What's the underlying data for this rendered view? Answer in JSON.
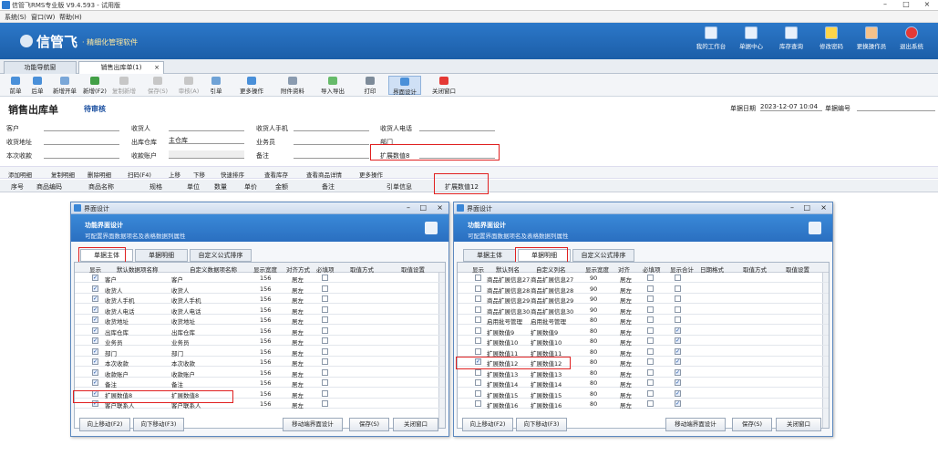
{
  "window": {
    "title": "信管飞RMS专业版 V9.4.593 - 试用版"
  },
  "menu": [
    "系统(S)",
    "窗口(W)",
    "帮助(H)"
  ],
  "banner": {
    "logo": "信管飞",
    "tagline": "· 精细化管理软件",
    "buttons": [
      "我的工作台",
      "单据中心",
      "库存查询",
      "修改密码",
      "更换操作员",
      "退出系统"
    ]
  },
  "tabs": [
    {
      "label": "功能导航窗"
    },
    {
      "label": "销售出库单(1)"
    }
  ],
  "tab_close": "×",
  "toolbar": [
    "前单",
    "后单",
    "新增开单",
    "新增(F2)",
    "复制新增",
    "保存(S)",
    "审核(A)",
    "引单",
    "更多操作",
    "附件资料",
    "导入导出",
    "打印",
    "界面设计",
    "关闭窗口"
  ],
  "doc": {
    "title": "销售出库单",
    "status": "待审核",
    "date_label": "单据日期",
    "date_value": "2023-12-07 10:04",
    "no_label": "单据编号"
  },
  "form": {
    "customer": "客户",
    "receiver": "收货人",
    "receiver_phone": "收货人手机",
    "receiver_tel": "收货人电话",
    "address": "收货地址",
    "warehouse": "出库仓库",
    "warehouse_value": "主仓库",
    "salesman": "业务员",
    "dept": "部门",
    "receipt": "本次收款",
    "account": "收款账户",
    "remark": "备注",
    "ext8": "扩展数值8"
  },
  "detail_toolbar": [
    "添加明细",
    "复制明细",
    "删除明细",
    "扫码(F4)",
    "上移",
    "下移",
    "快速排序",
    "查看库存",
    "查看商品详情",
    "更多操作"
  ],
  "detail_columns": [
    "序号",
    "商品编码",
    "商品名称",
    "规格",
    "单位",
    "数量",
    "单价",
    "金额",
    "备注",
    "引单信息",
    "扩展数值12"
  ],
  "dialog_left": {
    "title": "界面设计",
    "header_a": "功能界面设计",
    "header_b": "可配置界面数据项名及表格数据列属性",
    "tabs": [
      "单据主体",
      "单据明细",
      "自定义公式排序"
    ],
    "columns": [
      "显示",
      "默认数据项名称",
      "自定义数据项名称",
      "显示宽度",
      "对齐方式",
      "必填项",
      "取值方式",
      "取值设置"
    ],
    "rows": [
      {
        "a": "客户",
        "b": "客户",
        "w": "156",
        "al": "居左",
        "on": true,
        "req": false
      },
      {
        "a": "收货人",
        "b": "收货人",
        "w": "156",
        "al": "居左",
        "on": true,
        "req": false
      },
      {
        "a": "收货人手机",
        "b": "收货人手机",
        "w": "156",
        "al": "居左",
        "on": true,
        "req": false
      },
      {
        "a": "收货人电话",
        "b": "收货人电话",
        "w": "156",
        "al": "居左",
        "on": true,
        "req": false
      },
      {
        "a": "收货地址",
        "b": "收货地址",
        "w": "156",
        "al": "居左",
        "on": true,
        "req": false
      },
      {
        "a": "出库仓库",
        "b": "出库仓库",
        "w": "156",
        "al": "居左",
        "on": true,
        "req": false
      },
      {
        "a": "业务员",
        "b": "业务员",
        "w": "156",
        "al": "居左",
        "on": true,
        "req": false
      },
      {
        "a": "部门",
        "b": "部门",
        "w": "156",
        "al": "居左",
        "on": true,
        "req": false
      },
      {
        "a": "本次收款",
        "b": "本次收款",
        "w": "156",
        "al": "居左",
        "on": true,
        "req": false
      },
      {
        "a": "收款账户",
        "b": "收款账户",
        "w": "156",
        "al": "居左",
        "on": true,
        "req": false
      },
      {
        "a": "备注",
        "b": "备注",
        "w": "156",
        "al": "居左",
        "on": true,
        "req": false
      },
      {
        "a": "扩展数值8",
        "b": "扩展数值8",
        "w": "156",
        "al": "居左",
        "on": true,
        "req": false
      },
      {
        "a": "客户联系人",
        "b": "客户联系人",
        "w": "156",
        "al": "居左",
        "on": true,
        "req": false
      }
    ],
    "buttons": [
      "向上移动(F2)",
      "向下移动(F3)",
      "移动端界面设计",
      "保存(S)",
      "关闭窗口"
    ]
  },
  "dialog_right": {
    "title": "界面设计",
    "header_a": "功能界面设计",
    "header_b": "可配置界面数据项名及表格数据列属性",
    "tabs": [
      "单据主体",
      "单据明细",
      "自定义公式排序"
    ],
    "columns": [
      "显示",
      "默认列名",
      "自定义列名",
      "显示宽度",
      "对齐",
      "必填项",
      "显示合计",
      "日期格式",
      "取值方式",
      "取值设置"
    ],
    "rows": [
      {
        "a": "商品扩展信息27",
        "b": "商品扩展信息27",
        "w": "90",
        "al": "居左",
        "on": false,
        "req": false,
        "sum": false
      },
      {
        "a": "商品扩展信息28",
        "b": "商品扩展信息28",
        "w": "90",
        "al": "居左",
        "on": false,
        "req": false,
        "sum": false
      },
      {
        "a": "商品扩展信息29",
        "b": "商品扩展信息29",
        "w": "90",
        "al": "居左",
        "on": false,
        "req": false,
        "sum": false
      },
      {
        "a": "商品扩展信息30",
        "b": "商品扩展信息30",
        "w": "90",
        "al": "居左",
        "on": false,
        "req": false,
        "sum": false
      },
      {
        "a": "启用批号管理",
        "b": "启用批号管理",
        "w": "80",
        "al": "居左",
        "on": false,
        "req": false,
        "sum": false
      },
      {
        "a": "扩展数值9",
        "b": "扩展数值9",
        "w": "80",
        "al": "居左",
        "on": false,
        "req": false,
        "sum": true
      },
      {
        "a": "扩展数值10",
        "b": "扩展数值10",
        "w": "80",
        "al": "居左",
        "on": false,
        "req": false,
        "sum": true
      },
      {
        "a": "扩展数值11",
        "b": "扩展数值11",
        "w": "80",
        "al": "居左",
        "on": false,
        "req": false,
        "sum": true
      },
      {
        "a": "扩展数值12",
        "b": "扩展数值12",
        "w": "80",
        "al": "居左",
        "on": true,
        "req": false,
        "sum": true
      },
      {
        "a": "扩展数值13",
        "b": "扩展数值13",
        "w": "80",
        "al": "居左",
        "on": false,
        "req": false,
        "sum": true
      },
      {
        "a": "扩展数值14",
        "b": "扩展数值14",
        "w": "80",
        "al": "居左",
        "on": false,
        "req": false,
        "sum": true
      },
      {
        "a": "扩展数值15",
        "b": "扩展数值15",
        "w": "80",
        "al": "居左",
        "on": false,
        "req": false,
        "sum": true
      },
      {
        "a": "扩展数值16",
        "b": "扩展数值16",
        "w": "80",
        "al": "居左",
        "on": false,
        "req": false,
        "sum": true
      }
    ],
    "buttons": [
      "向上移动(F2)",
      "向下移动(F3)",
      "移动端界面设计",
      "保存(S)",
      "关闭窗口"
    ]
  },
  "colors": {
    "accent": "#2c78c9",
    "highlight": "#e02020"
  }
}
